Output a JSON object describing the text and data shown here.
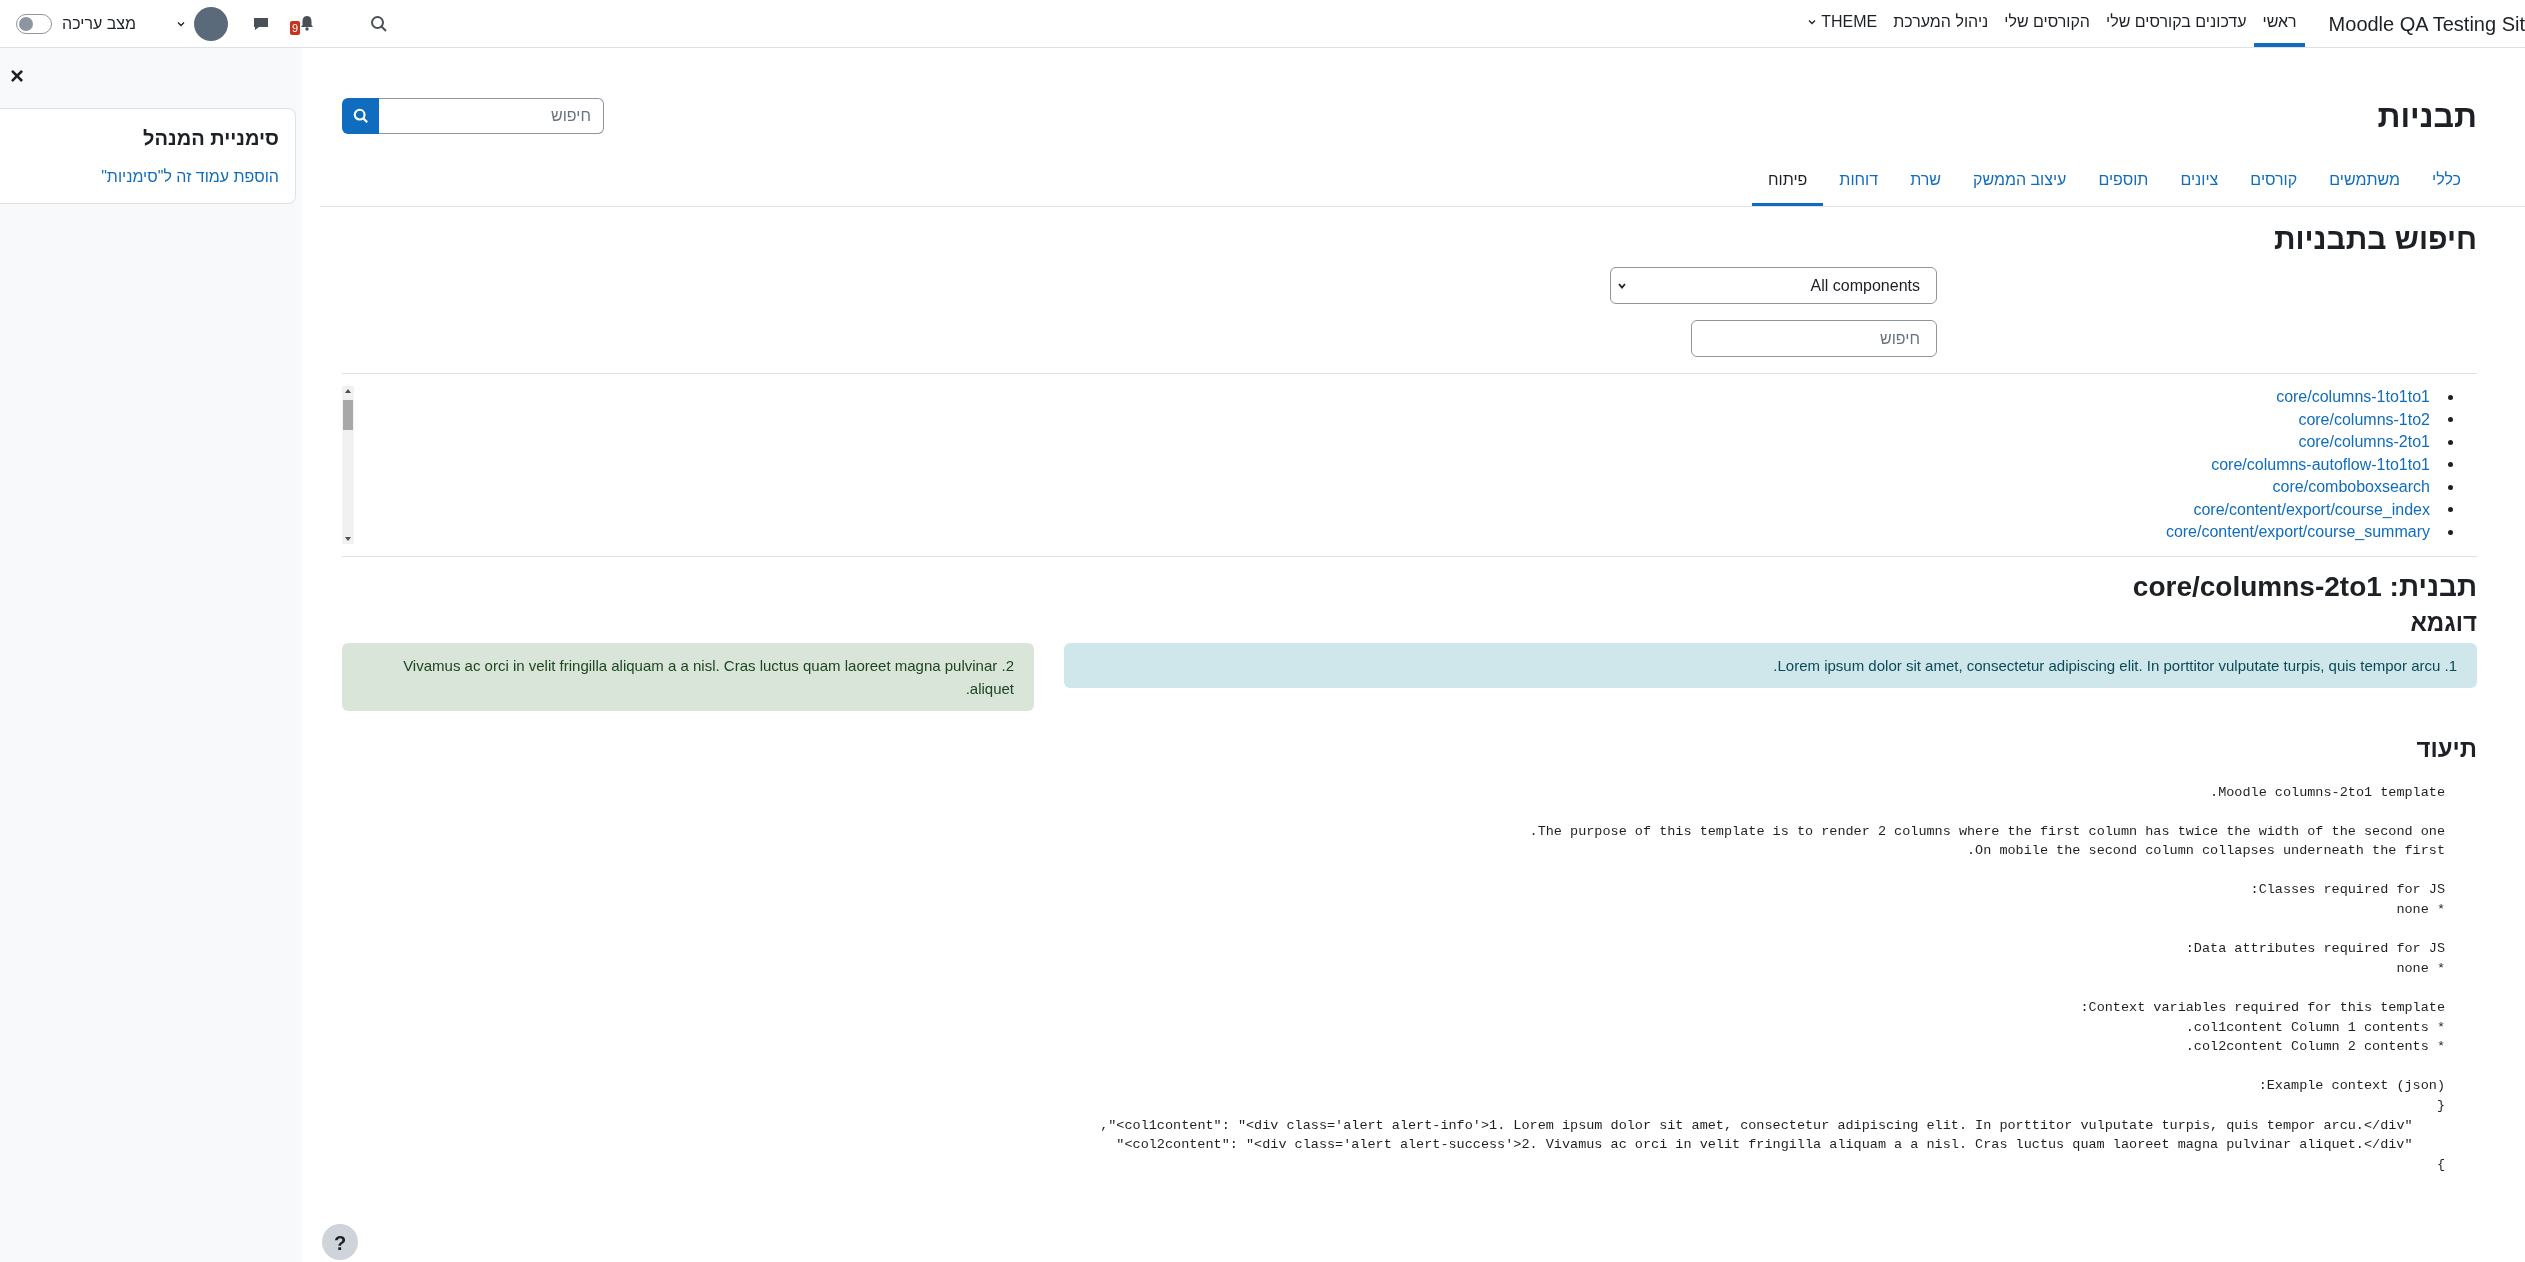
{
  "navbar": {
    "site_name": "Moodle QA Testing Sit",
    "items": [
      {
        "label": "ראשי",
        "selected": true,
        "kind": "link"
      },
      {
        "label": "עדכונים בקורסים שלי",
        "selected": false,
        "kind": "link"
      },
      {
        "label": "הקורסים שלי",
        "selected": false,
        "kind": "link"
      },
      {
        "label": "ניהול המערכת",
        "selected": false,
        "kind": "link"
      },
      {
        "label": "THEME",
        "selected": false,
        "kind": "menu"
      }
    ],
    "notification_count": "9",
    "edit_mode": {
      "label": "מצב עריכה",
      "on": false
    }
  },
  "page": {
    "title": "תבניות",
    "search": {
      "placeholder": "חיפוש"
    },
    "tabs": [
      {
        "label": "כללי",
        "selected": false
      },
      {
        "label": "משתמשים",
        "selected": false
      },
      {
        "label": "קורסים",
        "selected": false
      },
      {
        "label": "ציונים",
        "selected": false
      },
      {
        "label": "תוספים",
        "selected": false
      },
      {
        "label": "עיצוב הממשק",
        "selected": false
      },
      {
        "label": "שרת",
        "selected": false
      },
      {
        "label": "דוחות",
        "selected": false
      },
      {
        "label": "פיתוח",
        "selected": true
      }
    ],
    "template_search": {
      "heading": "חיפוש בתבניות",
      "component_select": "All components",
      "search_placeholder": "חיפוש"
    },
    "templates": [
      "core/columns-1to1to1",
      "core/columns-1to2",
      "core/columns-2to1",
      "core/columns-autoflow-1to1to1",
      "core/comboboxsearch",
      "core/content/export/course_index",
      "core/content/export/course_summary"
    ],
    "template_heading": "תבנית: core/columns-2to1",
    "example_heading": "דוגמא",
    "example_columns": [
      {
        "kind": "info",
        "text": "1. Lorem ipsum dolor sit amet, consectetur adipiscing elit. In porttitor vulputate turpis, quis tempor arcu."
      },
      {
        "kind": "success",
        "text": "2. Vivamus ac orci in velit fringilla aliquam a a nisl. Cras luctus quam laoreet magna pulvinar aliquet."
      }
    ],
    "documentation_heading": "תיעוד",
    "documentation": "Moodle columns-2to1 template.\n\nThe purpose of this template is to render 2 columns where the first column has twice the width of the second one.\nOn mobile the second column collapses underneath the first.\n\nClasses required for JS:\n* none\n\nData attributes required for JS:\n* none\n\nContext variables required for this template:\n* col1content Column 1 contents.\n* col2content Column 2 contents.\n\nExample context (json):\n{\n    \"col1content\": \"<div class='alert alert-info'>1. Lorem ipsum dolor sit amet, consectetur adipiscing elit. In porttitor vulputate turpis, quis tempor arcu.</div>\",\n    \"col2content\": \"<div class='alert alert-success'>2. Vivamus ac orci in velit fringilla aliquam a a nisl. Cras luctus quam laoreet magna pulvinar aliquet.</div>\"\n}",
    "help_button": "?"
  },
  "drawer": {
    "close": "×",
    "block_title": "סימניית המנהל",
    "link": "הוספת עמוד זה ל\"סימניות\""
  }
}
